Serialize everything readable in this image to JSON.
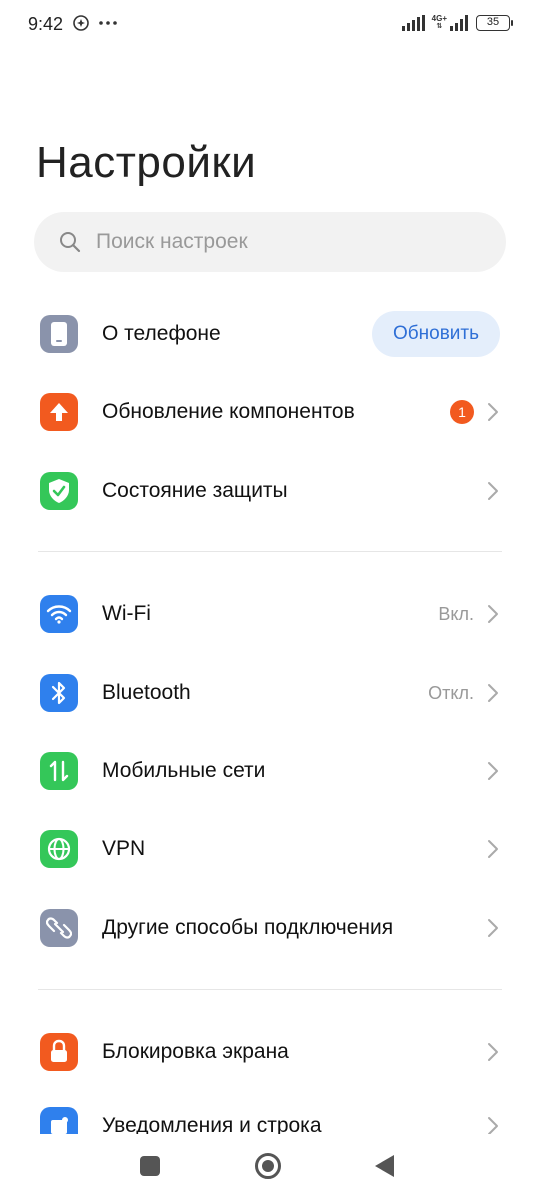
{
  "status_bar": {
    "time": "9:42",
    "network_label": "4G+",
    "battery": "35",
    "icons": [
      "location-icon",
      "more-dots-icon",
      "signal-icon",
      "signal-4g-icon",
      "battery-icon"
    ]
  },
  "page": {
    "title": "Настройки"
  },
  "search": {
    "placeholder": "Поиск настроек"
  },
  "colors": {
    "phone": "#8a93ab",
    "update": "#f25a1f",
    "security": "#34c759",
    "wifi": "#2f80ed",
    "bluetooth": "#2f80ed",
    "mobile": "#34c759",
    "vpn": "#34c759",
    "other": "#8a93ab",
    "lock": "#f25a1f",
    "notifications": "#2f80ed"
  },
  "items": {
    "about_phone": {
      "label": "О телефоне",
      "action": "Обновить",
      "icon": "phone-icon"
    },
    "component_update": {
      "label": "Обновление компонентов",
      "badge": "1",
      "icon": "arrow-up-icon"
    },
    "security_status": {
      "label": "Состояние защиты",
      "icon": "shield-check-icon"
    },
    "wifi": {
      "label": "Wi-Fi",
      "value": "Вкл.",
      "icon": "wifi-icon"
    },
    "bluetooth": {
      "label": "Bluetooth",
      "value": "Откл.",
      "icon": "bluetooth-icon"
    },
    "mobile_networks": {
      "label": "Мобильные сети",
      "icon": "mobile-data-icon"
    },
    "vpn": {
      "label": "VPN",
      "icon": "globe-icon"
    },
    "other_connections": {
      "label": "Другие способы подключения",
      "icon": "link-icon"
    },
    "lock_screen": {
      "label": "Блокировка экрана",
      "icon": "lock-icon"
    },
    "notifications": {
      "label": "Уведомления и строка",
      "icon": "notification-icon"
    }
  }
}
